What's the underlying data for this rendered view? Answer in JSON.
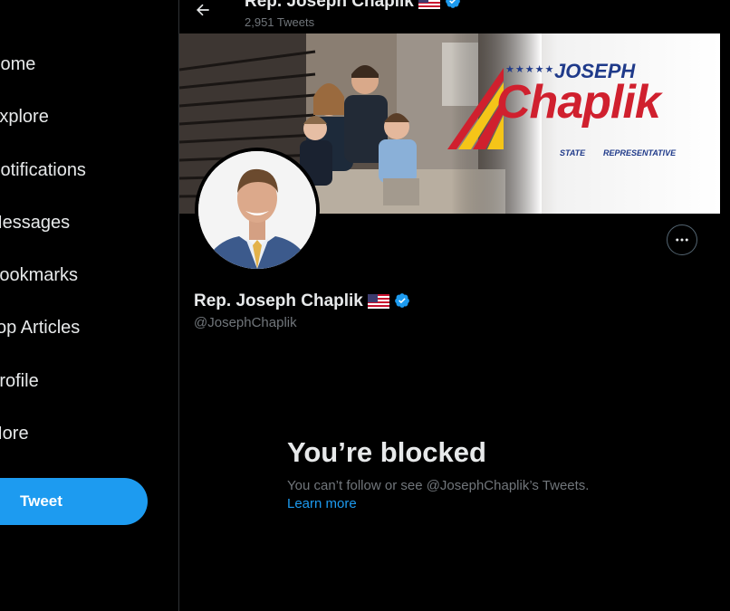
{
  "sidebar": {
    "items": [
      {
        "label": "Home",
        "icon": "home-icon"
      },
      {
        "label": "Explore",
        "icon": "explore-icon"
      },
      {
        "label": "Notifications",
        "icon": "bell-icon"
      },
      {
        "label": "Messages",
        "icon": "mail-icon"
      },
      {
        "label": "Bookmarks",
        "icon": "bookmark-icon"
      },
      {
        "label": "Top Articles",
        "icon": "articles-icon"
      },
      {
        "label": "Profile",
        "icon": "person-icon"
      },
      {
        "label": "More",
        "icon": "more-circle-icon"
      }
    ],
    "tweet_button": "Tweet"
  },
  "header": {
    "name": "Rep. Joseph Chaplik",
    "tweet_count": "2,951 Tweets"
  },
  "banner": {
    "logo_top": "JOSEPH",
    "logo_main": "Chaplik",
    "logo_left": "STATE",
    "logo_right": "REPRESENTATIVE",
    "logo_stars": "★★★★★"
  },
  "profile": {
    "display_name": "Rep. Joseph Chaplik",
    "handle": "@JosephChaplik",
    "verified": true,
    "flag": "us-flag-icon"
  },
  "blocked": {
    "title": "You’re blocked",
    "message": "You can’t follow or see @JosephChaplik’s Tweets.",
    "link": "Learn more"
  },
  "colors": {
    "background": "#000000",
    "accent": "#1d9bf0",
    "text_primary": "#e7e9ea",
    "text_secondary": "#71767b",
    "logo_red": "#d0202e",
    "logo_navy": "#1f3a8a",
    "logo_yellow": "#f5c518"
  }
}
